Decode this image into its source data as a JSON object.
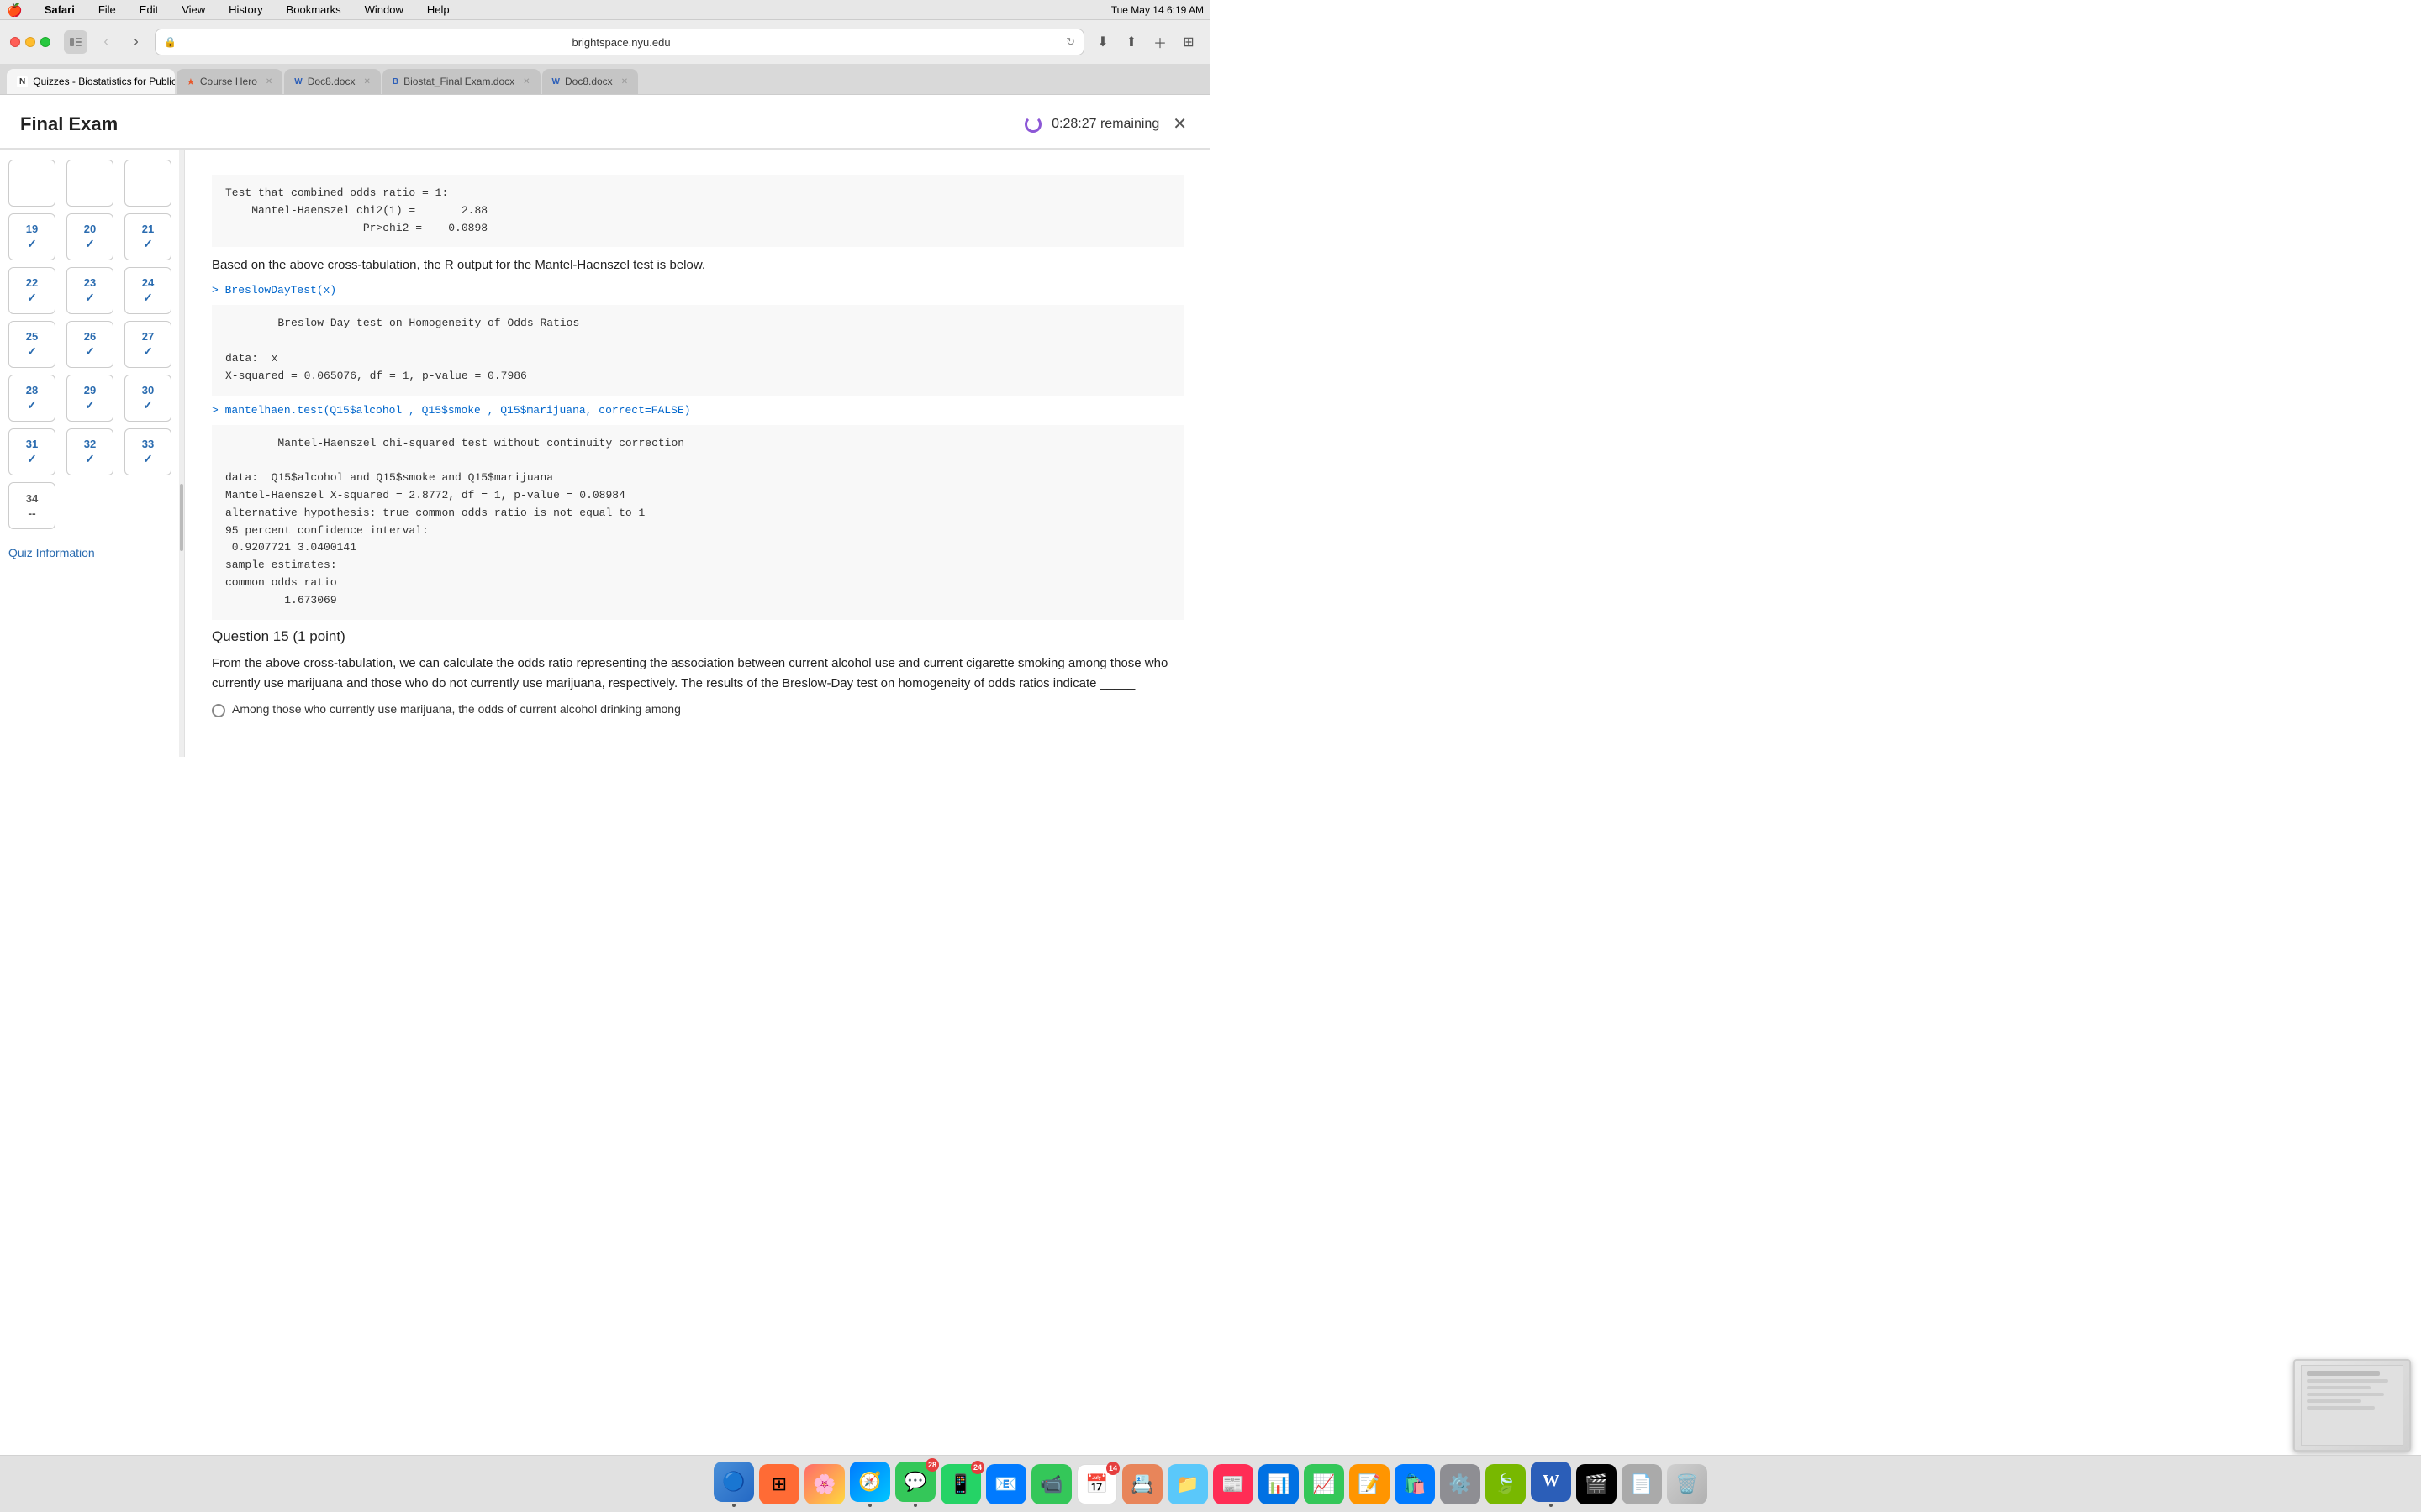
{
  "menubar": {
    "apple": "🍎",
    "app": "Safari",
    "items": [
      "File",
      "Edit",
      "View",
      "History",
      "Bookmarks",
      "Window",
      "Help"
    ],
    "right": {
      "time": "Tue May 14  6:19 AM"
    }
  },
  "browser": {
    "url": "brightspace.nyu.edu",
    "tabs": [
      {
        "id": "tab1",
        "favicon": "N",
        "label": "Quizzes - Biostatistics for Public Health,...",
        "active": true
      },
      {
        "id": "tab2",
        "favicon": "★",
        "label": "Course Hero",
        "active": false
      },
      {
        "id": "tab3",
        "favicon": "W",
        "label": "Doc8.docx",
        "active": false
      },
      {
        "id": "tab4",
        "favicon": "B",
        "label": "Biostat_Final Exam.docx",
        "active": false
      },
      {
        "id": "tab5",
        "favicon": "W",
        "label": "Doc8.docx",
        "active": false
      }
    ]
  },
  "exam": {
    "title": "Final Exam",
    "timer": "0:28:27  remaining"
  },
  "sidebar": {
    "questions": [
      {
        "num": "",
        "check": "",
        "row": "top",
        "empty": true
      },
      {
        "num": "",
        "check": "",
        "row": "top",
        "empty": true
      },
      {
        "num": "",
        "check": "",
        "row": "top",
        "empty": true
      },
      {
        "num": "19",
        "check": "✓",
        "answered": true
      },
      {
        "num": "20",
        "check": "✓",
        "answered": true
      },
      {
        "num": "21",
        "check": "✓",
        "answered": true
      },
      {
        "num": "22",
        "check": "✓",
        "answered": true
      },
      {
        "num": "23",
        "check": "✓",
        "answered": true
      },
      {
        "num": "24",
        "check": "✓",
        "answered": true
      },
      {
        "num": "25",
        "check": "✓",
        "answered": true
      },
      {
        "num": "26",
        "check": "✓",
        "answered": true
      },
      {
        "num": "27",
        "check": "✓",
        "answered": true
      },
      {
        "num": "28",
        "check": "✓",
        "answered": true
      },
      {
        "num": "29",
        "check": "✓",
        "answered": true
      },
      {
        "num": "30",
        "check": "✓",
        "answered": true
      },
      {
        "num": "31",
        "check": "✓",
        "answered": true
      },
      {
        "num": "32",
        "check": "✓",
        "answered": true
      },
      {
        "num": "33",
        "check": "✓",
        "answered": true
      },
      {
        "num": "34",
        "check": "--",
        "answered": false
      }
    ],
    "quiz_info_label": "Quiz Information"
  },
  "content": {
    "code_block1": "Test that combined odds ratio = 1:\n    Mantel-Haenszel chi2(1) =       2.88\n                     Pr>chi2 =    0.0898",
    "paragraph1": "Based on the above cross-tabulation, the R output for the Mantel-Haenszel test is below.",
    "r_cmd1": "> BreslowDayTest(x)",
    "code_block2": "        Breslow-Day test on Homogeneity of Odds Ratios\n\ndata:  x\nX-squared = 0.065076, df = 1, p-value = 0.7986",
    "r_cmd2": "> mantelhaen.test(Q15$alcohol , Q15$smoke , Q15$marijuana, correct=FALSE)",
    "code_block3": "        Mantel-Haenszel chi-squared test without continuity correction\n\ndata:  Q15$alcohol and Q15$smoke and Q15$marijuana\nMantel-Haenszel X-squared = 2.8772, df = 1, p-value = 0.08984\nalternative hypothesis: true common odds ratio is not equal to 1\n95 percent confidence interval:\n 0.9207721 3.0400141\nsample estimates:\ncommon odds ratio\n         1.673069",
    "question15_heading": "Question 15",
    "question15_points": " (1 point)",
    "question15_text": "From the above cross-tabulation, we can calculate the odds ratio representing the association between current alcohol use and current cigarette smoking among those who currently use marijuana and those who do not currently use marijuana, respectively. The results of the Breslow-Day test on homogeneity of odds ratios indicate _____",
    "answer1_text": "Among those who currently use marijuana, the odds of current alcohol drinking among"
  },
  "dock": {
    "items": [
      {
        "icon": "🔵",
        "label": "Finder",
        "color": "#0066cc",
        "badge": null,
        "active": true
      },
      {
        "icon": "🟦",
        "label": "Launchpad",
        "color": "#ff6b35",
        "badge": null,
        "active": false
      },
      {
        "icon": "🌸",
        "label": "Photos",
        "color": "#e91e8c",
        "badge": null,
        "active": false
      },
      {
        "icon": "🧭",
        "label": "Safari",
        "color": "#0099ff",
        "badge": null,
        "active": true
      },
      {
        "icon": "💬",
        "label": "Messages",
        "color": "#34c759",
        "badge": "28",
        "active": true
      },
      {
        "icon": "📱",
        "label": "WhatsApp",
        "color": "#25d366",
        "badge": "24",
        "active": false
      },
      {
        "icon": "📧",
        "label": "Mail",
        "color": "#007aff",
        "badge": null,
        "active": false
      },
      {
        "icon": "📹",
        "label": "FaceTime",
        "color": "#34c759",
        "badge": null,
        "active": false
      },
      {
        "icon": "📅",
        "label": "Calendar",
        "color": "#ff3b30",
        "badge": "14",
        "active": false
      },
      {
        "icon": "📇",
        "label": "Contacts",
        "color": "#e8855a",
        "badge": null,
        "active": false
      },
      {
        "icon": "📁",
        "label": "Files",
        "color": "#5ac8fa",
        "badge": null,
        "active": false
      },
      {
        "icon": "📰",
        "label": "News",
        "color": "#ff2d55",
        "badge": null,
        "active": false
      },
      {
        "icon": "📊",
        "label": "Keynote",
        "color": "#0071e3",
        "badge": null,
        "active": false
      },
      {
        "icon": "📈",
        "label": "Numbers",
        "color": "#34c759",
        "badge": null,
        "active": false
      },
      {
        "icon": "📝",
        "label": "Pages",
        "color": "#ff9500",
        "badge": null,
        "active": false
      },
      {
        "icon": "🛍️",
        "label": "App Store",
        "color": "#007aff",
        "badge": null,
        "active": false
      },
      {
        "icon": "⚙️",
        "label": "System Preferences",
        "color": "#8e8e93",
        "badge": null,
        "active": false
      },
      {
        "icon": "🍃",
        "label": "uTorrent",
        "color": "#78b800",
        "badge": null,
        "active": false
      },
      {
        "icon": "W",
        "label": "Word",
        "color": "#2b5eb8",
        "badge": null,
        "active": false
      },
      {
        "icon": "🎬",
        "label": "TV",
        "color": "#000",
        "badge": null,
        "active": false
      },
      {
        "icon": "📄",
        "label": "Doc",
        "color": "#555",
        "badge": null,
        "active": false
      },
      {
        "icon": "🗑️",
        "label": "Trash",
        "color": "#8e8e93",
        "badge": null,
        "active": false
      }
    ]
  }
}
